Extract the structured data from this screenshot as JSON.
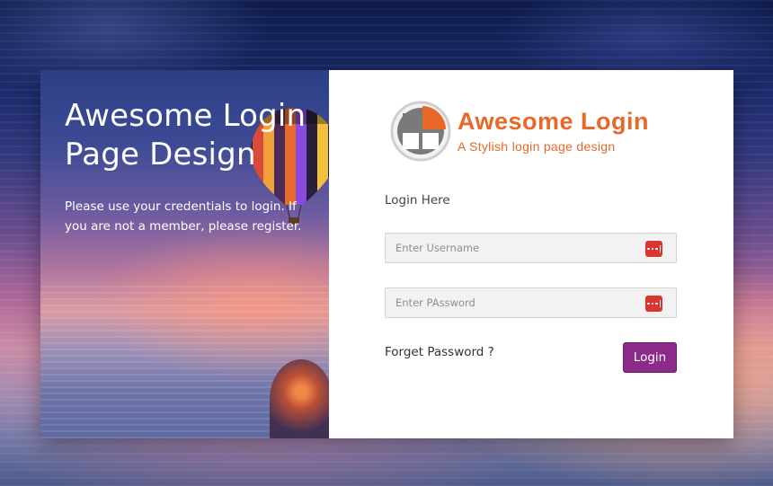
{
  "left": {
    "title_line1": "Awesome Login",
    "title_line2": "Page Design",
    "subtitle": "Please use your credentials to login. If you are not a member, please register."
  },
  "logo": {
    "title": "Awesome Login",
    "subtitle": "A Stylish login page design"
  },
  "form": {
    "heading": "Login Here",
    "username_placeholder": "Enter Username",
    "password_placeholder": "Enter PAssword",
    "forgot_label": "Forget Password ?",
    "login_label": "Login"
  },
  "colors": {
    "accent": "#e8682a",
    "button": "#8c2a8a",
    "field_icon": "#d9362f"
  },
  "icons": {
    "field_icon": "password-dots-icon"
  }
}
